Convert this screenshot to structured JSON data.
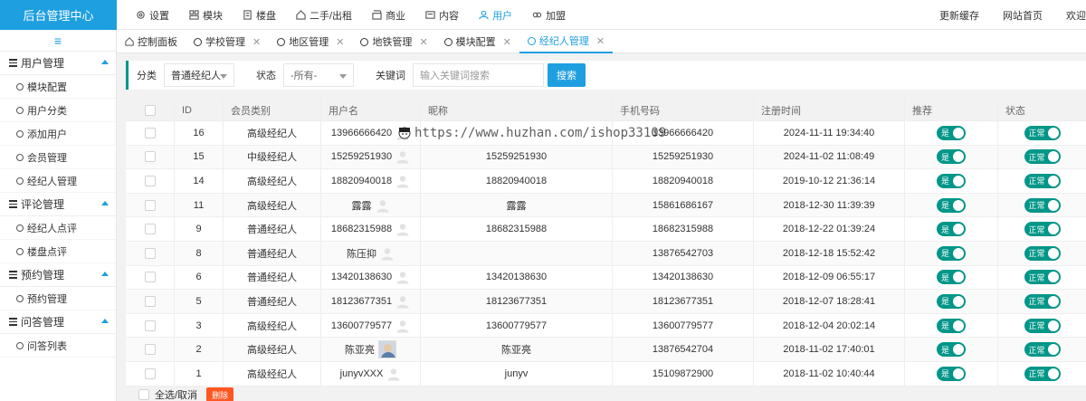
{
  "brand": "后台管理中心",
  "topnav": [
    {
      "label": "设置",
      "icon": "gear-icon",
      "active": false
    },
    {
      "label": "模块",
      "icon": "module-icon",
      "active": false
    },
    {
      "label": "楼盘",
      "icon": "building-icon",
      "active": false
    },
    {
      "label": "二手/出租",
      "icon": "house-icon",
      "active": false
    },
    {
      "label": "商业",
      "icon": "shop-icon",
      "active": false
    },
    {
      "label": "内容",
      "icon": "content-icon",
      "active": false
    },
    {
      "label": "用户",
      "icon": "user-icon",
      "active": true
    },
    {
      "label": "加盟",
      "icon": "join-icon",
      "active": false
    }
  ],
  "topright": {
    "cache": "更新缓存",
    "home": "网站首页",
    "welcome": "欢迎"
  },
  "sidebar": {
    "toggle": "≡",
    "groups": [
      {
        "title": "用户管理",
        "items": [
          "模块配置",
          "用户分类",
          "添加用户",
          "会员管理",
          "经纪人管理"
        ]
      },
      {
        "title": "评论管理",
        "items": [
          "经纪人点评",
          "楼盘点评"
        ]
      },
      {
        "title": "预约管理",
        "items": [
          "预约管理"
        ]
      },
      {
        "title": "问答管理",
        "items": [
          "问答列表"
        ]
      }
    ]
  },
  "tabs": [
    {
      "label": "控制面板",
      "icon": "home-icon",
      "closable": false,
      "active": false
    },
    {
      "label": "学校管理",
      "closable": true,
      "active": false
    },
    {
      "label": "地区管理",
      "closable": true,
      "active": false
    },
    {
      "label": "地铁管理",
      "closable": true,
      "active": false
    },
    {
      "label": "模块配置",
      "closable": true,
      "active": false
    },
    {
      "label": "经纪人管理",
      "closable": true,
      "active": true
    }
  ],
  "filter": {
    "category_label": "分类",
    "category_value": "普通经纪人",
    "status_label": "状态",
    "status_value": "-所有-",
    "keyword_label": "关键词",
    "keyword_placeholder": "输入关键词搜索",
    "search_label": "搜索"
  },
  "table": {
    "headers": [
      "",
      "ID",
      "会员类别",
      "用户名",
      "昵称",
      "手机号码",
      "注册时间",
      "推荐",
      "状态"
    ],
    "rows": [
      {
        "id": "16",
        "type": "高级经纪人",
        "username": "13966666420",
        "avatar": "default",
        "nickname": "",
        "phone": "13966666420",
        "regtime": "2024-11-11 19:34:40",
        "recommend": "是",
        "status": "正常"
      },
      {
        "id": "15",
        "type": "中级经纪人",
        "username": "15259251930",
        "avatar": "default",
        "nickname": "15259251930",
        "phone": "15259251930",
        "regtime": "2024-11-02 11:08:49",
        "recommend": "是",
        "status": "正常"
      },
      {
        "id": "14",
        "type": "高级经纪人",
        "username": "18820940018",
        "avatar": "default",
        "nickname": "18820940018",
        "phone": "18820940018",
        "regtime": "2019-10-12 21:36:14",
        "recommend": "是",
        "status": "正常"
      },
      {
        "id": "11",
        "type": "高级经纪人",
        "username": "露露",
        "avatar": "default",
        "nickname": "露露",
        "phone": "15861686167",
        "regtime": "2018-12-30 11:39:39",
        "recommend": "是",
        "status": "正常"
      },
      {
        "id": "9",
        "type": "普通经纪人",
        "username": "18682315988",
        "avatar": "default",
        "nickname": "18682315988",
        "phone": "18682315988",
        "regtime": "2018-12-22 01:39:24",
        "recommend": "是",
        "status": "正常"
      },
      {
        "id": "8",
        "type": "普通经纪人",
        "username": "陈压抑",
        "avatar": "default",
        "nickname": "",
        "phone": "13876542703",
        "regtime": "2018-12-18 15:52:42",
        "recommend": "是",
        "status": "正常"
      },
      {
        "id": "6",
        "type": "普通经纪人",
        "username": "13420138630",
        "avatar": "default",
        "nickname": "13420138630",
        "phone": "13420138630",
        "regtime": "2018-12-09 06:55:17",
        "recommend": "是",
        "status": "正常"
      },
      {
        "id": "5",
        "type": "普通经纪人",
        "username": "18123677351",
        "avatar": "default",
        "nickname": "18123677351",
        "phone": "18123677351",
        "regtime": "2018-12-07 18:28:41",
        "recommend": "是",
        "status": "正常"
      },
      {
        "id": "3",
        "type": "高级经纪人",
        "username": "13600779577",
        "avatar": "default",
        "nickname": "13600779577",
        "phone": "13600779577",
        "regtime": "2018-12-04 20:02:14",
        "recommend": "是",
        "status": "正常"
      },
      {
        "id": "2",
        "type": "高级经纪人",
        "username": "陈亚亮",
        "avatar": "photo",
        "nickname": "陈亚亮",
        "phone": "13876542704",
        "regtime": "2018-11-02 17:40:01",
        "recommend": "是",
        "status": "正常"
      },
      {
        "id": "1",
        "type": "高级经纪人",
        "username": "junyvXXX",
        "avatar": "default",
        "nickname": "junyv",
        "phone": "15109872900",
        "regtime": "2018-11-02 10:40:44",
        "recommend": "是",
        "status": "正常"
      }
    ]
  },
  "footer": {
    "select_all": "全选/取消",
    "delete": "删除"
  },
  "watermark": "https://www.huzhan.com/ishop33109",
  "colors": {
    "brand": "#1e9fe0",
    "switch": "#009688",
    "delete": "#ff5722"
  }
}
